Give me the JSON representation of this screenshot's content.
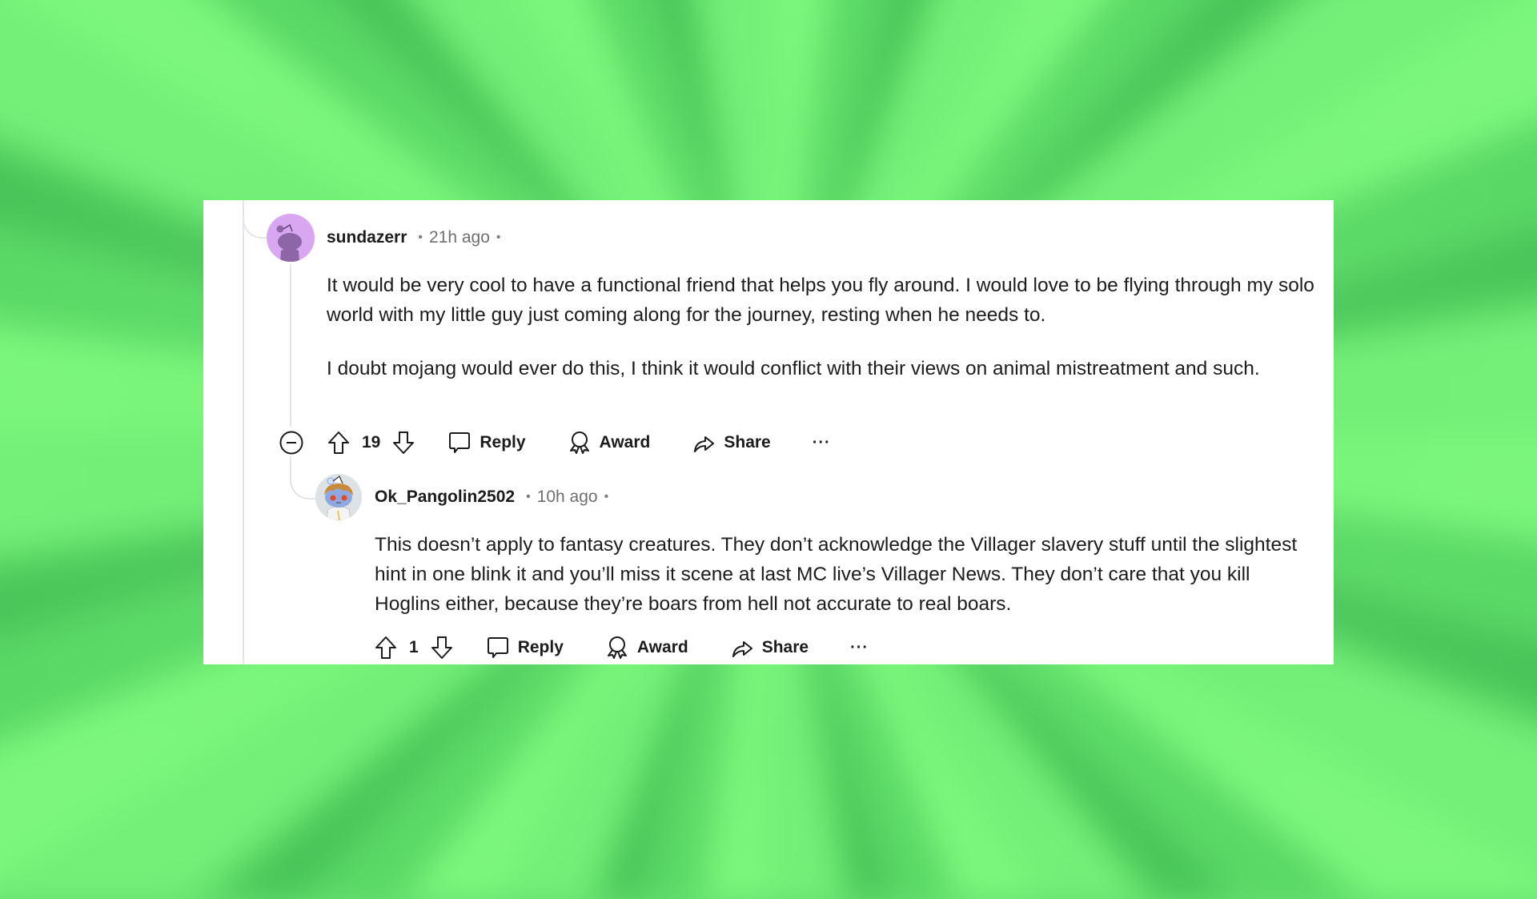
{
  "comments": [
    {
      "username": "sundazerr",
      "separator": "•",
      "time": "21h ago",
      "avatar_icon": "snoo-avatar-purple",
      "paragraphs": [
        "It would be very cool to have a functional friend that helps you fly around. I would love to be flying through my solo world with my little guy just coming along for the journey, resting when he needs to.",
        "I doubt mojang would ever do this, I think it would conflict with their views on animal mistreatment and such."
      ],
      "votes": "19",
      "actions": {
        "reply": "Reply",
        "award": "Award",
        "share": "Share",
        "more": "···"
      }
    },
    {
      "username": "Ok_Pangolin2502",
      "separator": "•",
      "time": "10h ago",
      "avatar_icon": "snoo-avatar-custom",
      "paragraphs": [
        "This doesn’t apply to fantasy creatures. They don’t acknowledge the Villager slavery stuff until the slightest hint in one blink it and you’ll miss it scene at last MC live’s Villager News. They don’t care that you kill Hoglins either, because they’re boars from hell not accurate to real boars."
      ],
      "votes": "1",
      "actions": {
        "reply": "Reply",
        "award": "Award",
        "share": "Share",
        "more": "···"
      }
    }
  ],
  "colors": {
    "background_green_light": "#7cf77c",
    "background_green_dark": "#48c458",
    "avatar1_bg": "#d9a6f2",
    "avatar1_fg": "#8d66a8",
    "text": "#1c1c1c",
    "muted": "#6f6f6f",
    "thread_line": "#e3e5e8"
  }
}
